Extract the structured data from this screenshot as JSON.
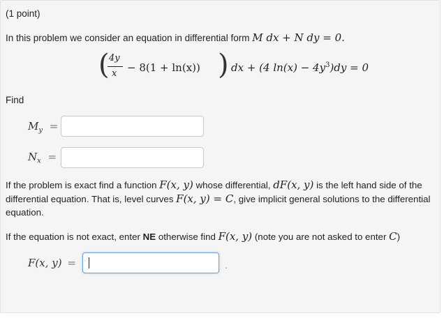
{
  "problem": {
    "points_label": "(1 point)",
    "intro_text": "In this problem we consider an equation in differential form",
    "intro_math": "M dx + N dy = 0.",
    "equation": {
      "frac_numerator": "4y",
      "frac_denominator": "x",
      "term_rest": "− 8(1 + ln(x))",
      "dx": "dx + (4 ln(x) − 4y",
      "exponent": "3",
      "tail": ")dy = 0"
    },
    "find_label": "Find",
    "fields": {
      "my_label": "M",
      "my_sub": "y",
      "my_value": "",
      "nx_label": "N",
      "nx_sub": "x",
      "nx_value": "",
      "eq_sign": "=",
      "f_label": "F(x, y)",
      "f_value": ""
    },
    "para_exact": {
      "t1": "If the problem is exact find a function",
      "m1": "F(x, y)",
      "t2": "whose differential,",
      "m2": "dF(x, y)",
      "t3": "is the left hand side of the differential equation. That is, level curves",
      "m3": "F(x, y) = C",
      "t4": ", give implicit general solutions to the differential equation."
    },
    "para_not_exact": {
      "t1": "If the equation is not exact, enter",
      "bold": "NE",
      "t2": "otherwise find",
      "m1": "F(x, y)",
      "t3": "(note you are not asked to enter",
      "m2": "C",
      "t4": ")"
    },
    "trailing_dot": "."
  },
  "colors": {
    "panel_bg": "#f5f5f5",
    "focus_border": "#6aa3d6",
    "input_border": "#c8c8c8"
  }
}
